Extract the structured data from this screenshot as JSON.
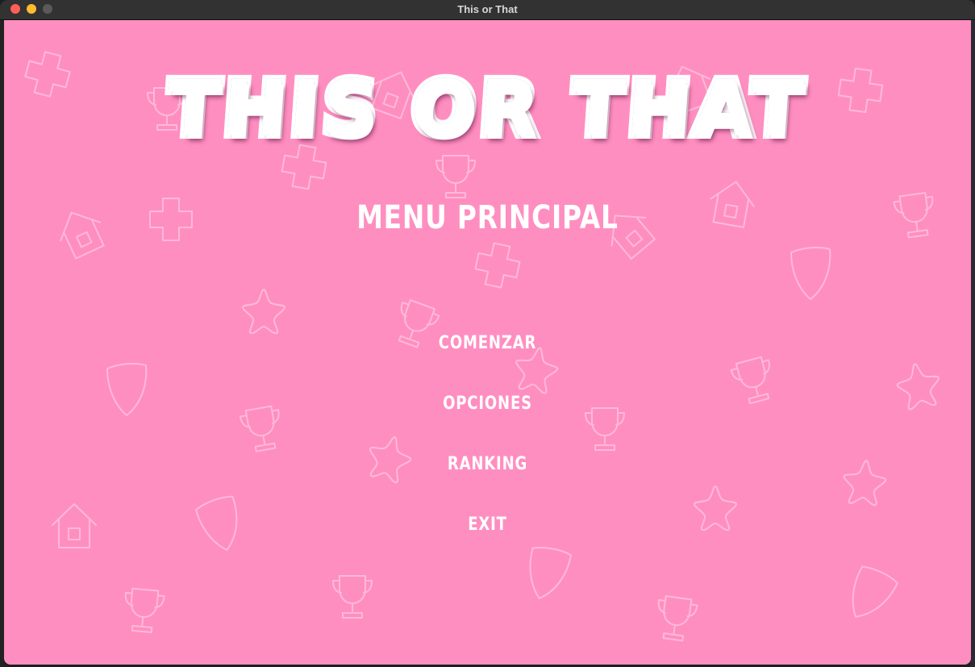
{
  "window": {
    "title": "This or That",
    "controls": [
      "close",
      "minimize",
      "maximize"
    ]
  },
  "game": {
    "logo_text": "THIS OR THAT",
    "menu_title": "MENU PRINCIPAL",
    "menu_items": [
      {
        "label": "COMENZAR"
      },
      {
        "label": "OPCIONES"
      },
      {
        "label": "RANKING"
      },
      {
        "label": "EXIT"
      }
    ],
    "background_icons": [
      "plus-icon",
      "trophy-icon",
      "house-icon",
      "shield-icon",
      "star-icon"
    ]
  },
  "colors": {
    "background": "#ff8ec0",
    "logo_fill": "#4a8ef5",
    "text": "#ffffff"
  }
}
